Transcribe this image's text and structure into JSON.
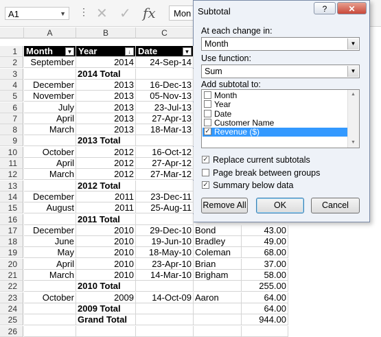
{
  "formula_bar": {
    "name_box": "A1",
    "dots": "⋮",
    "cancel_icon": "✕",
    "enter_icon": "✓",
    "fx_icon": "fx",
    "formula_value": "Mon"
  },
  "columns": [
    "A",
    "B",
    "C"
  ],
  "header_row": {
    "a": "Month",
    "b": "Year",
    "c": "Date"
  },
  "rows": [
    {
      "n": "1"
    },
    {
      "n": "2",
      "a": "September",
      "b": "2014",
      "c": "24-Sep-14"
    },
    {
      "n": "3",
      "b": "2014 Total",
      "total": true
    },
    {
      "n": "4",
      "a": "December",
      "b": "2013",
      "c": "16-Dec-13"
    },
    {
      "n": "5",
      "a": "November",
      "b": "2013",
      "c": "05-Nov-13"
    },
    {
      "n": "6",
      "a": "July",
      "b": "2013",
      "c": "23-Jul-13"
    },
    {
      "n": "7",
      "a": "April",
      "b": "2013",
      "c": "27-Apr-13"
    },
    {
      "n": "8",
      "a": "March",
      "b": "2013",
      "c": "18-Mar-13"
    },
    {
      "n": "9",
      "b": "2013 Total",
      "total": true
    },
    {
      "n": "10",
      "a": "October",
      "b": "2012",
      "c": "16-Oct-12"
    },
    {
      "n": "11",
      "a": "April",
      "b": "2012",
      "c": "27-Apr-12"
    },
    {
      "n": "12",
      "a": "March",
      "b": "2012",
      "c": "27-Mar-12"
    },
    {
      "n": "13",
      "b": "2012 Total",
      "total": true
    },
    {
      "n": "14",
      "a": "December",
      "b": "2011",
      "c": "23-Dec-11"
    },
    {
      "n": "15",
      "a": "August",
      "b": "2011",
      "c": "25-Aug-11"
    },
    {
      "n": "16",
      "b": "2011 Total",
      "total": true
    },
    {
      "n": "17",
      "a": "December",
      "b": "2010",
      "c": "29-Dec-10",
      "d": "Bond",
      "e": "43.00"
    },
    {
      "n": "18",
      "a": "June",
      "b": "2010",
      "c": "19-Jun-10",
      "d": "Bradley",
      "e": "49.00"
    },
    {
      "n": "19",
      "a": "May",
      "b": "2010",
      "c": "18-May-10",
      "d": "Coleman",
      "e": "68.00"
    },
    {
      "n": "20",
      "a": "April",
      "b": "2010",
      "c": "23-Apr-10",
      "d": "Brian",
      "e": "37.00"
    },
    {
      "n": "21",
      "a": "March",
      "b": "2010",
      "c": "14-Mar-10",
      "d": "Brigham",
      "e": "58.00"
    },
    {
      "n": "22",
      "b": "2010 Total",
      "total": true,
      "e": "255.00"
    },
    {
      "n": "23",
      "a": "October",
      "b": "2009",
      "c": "14-Oct-09",
      "d": "Aaron",
      "e": "64.00"
    },
    {
      "n": "24",
      "b": "2009 Total",
      "total": true,
      "e": "64.00"
    },
    {
      "n": "25",
      "b": "Grand Total",
      "total": true,
      "e": "944.00"
    },
    {
      "n": "26"
    }
  ],
  "dialog": {
    "title": "Subtotal",
    "help_label": "?",
    "close_label": "✕",
    "at_each_change_label": "At each change in:",
    "at_each_change_value": "Month",
    "use_function_label": "Use function:",
    "use_function_value": "Sum",
    "add_subtotal_label": "Add subtotal to:",
    "fields": [
      {
        "label": "Month",
        "checked": false
      },
      {
        "label": "Year",
        "checked": false
      },
      {
        "label": "Date",
        "checked": false
      },
      {
        "label": "Customer Name",
        "checked": false
      },
      {
        "label": "Revenue ($)",
        "checked": true
      }
    ],
    "options": [
      {
        "label": "Replace current subtotals",
        "checked": true
      },
      {
        "label": "Page break between groups",
        "checked": false
      },
      {
        "label": "Summary below data",
        "checked": true
      }
    ],
    "remove_all_label": "Remove All",
    "ok_label": "OK",
    "cancel_label": "Cancel"
  }
}
